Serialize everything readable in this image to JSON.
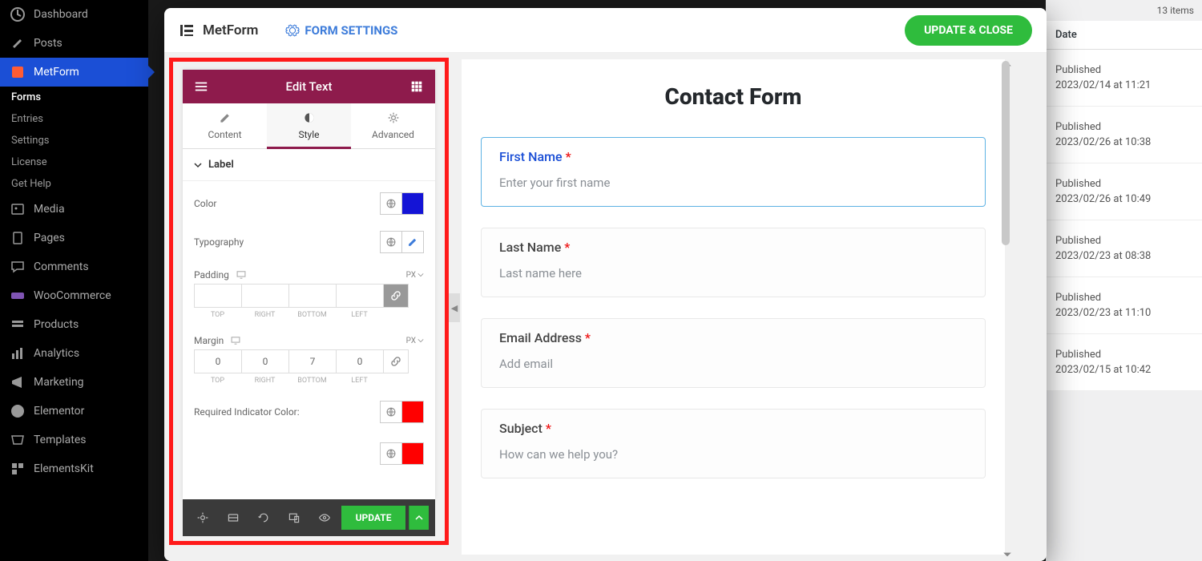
{
  "wp_sidebar": {
    "items": [
      {
        "label": "Dashboard",
        "icon": "dashboard"
      },
      {
        "label": "Posts",
        "icon": "pin"
      },
      {
        "label": "MetForm",
        "icon": "metform",
        "active": true
      },
      {
        "label": "Media",
        "icon": "media"
      },
      {
        "label": "Pages",
        "icon": "page"
      },
      {
        "label": "Comments",
        "icon": "comment"
      },
      {
        "label": "WooCommerce",
        "icon": "woo"
      },
      {
        "label": "Products",
        "icon": "products"
      },
      {
        "label": "Analytics",
        "icon": "analytics"
      },
      {
        "label": "Marketing",
        "icon": "marketing"
      },
      {
        "label": "Elementor",
        "icon": "elementor"
      },
      {
        "label": "Templates",
        "icon": "templates"
      },
      {
        "label": "ElementsKit",
        "icon": "elementskit"
      }
    ],
    "submenu": [
      "Forms",
      "Entries",
      "Settings",
      "License",
      "Get Help"
    ],
    "submenu_current": "Forms"
  },
  "right_col": {
    "items_count": "13 items",
    "header": "Date",
    "rows": [
      {
        "l1": "Published",
        "l2": "2023/02/14 at 11:21"
      },
      {
        "l1": "Published",
        "l2": "2023/02/26 at 10:38"
      },
      {
        "l1": "Published",
        "l2": "2023/02/26 at 10:49"
      },
      {
        "l1": "Published",
        "l2": "2023/02/23 at 08:38"
      },
      {
        "l1": "Published",
        "l2": "2023/02/23 at 11:10"
      },
      {
        "l1": "Published",
        "l2": "2023/02/15 at 10:42"
      }
    ]
  },
  "modal": {
    "brand": "MetForm",
    "form_settings": "FORM SETTINGS",
    "update_close": "UPDATE & CLOSE"
  },
  "panel": {
    "title": "Edit Text",
    "tabs": [
      "Content",
      "Style",
      "Advanced"
    ],
    "active_tab": "Style",
    "section_label": "Label",
    "color_label": "Color",
    "color_value": "#1414d6",
    "typography_label": "Typography",
    "padding_label": "Padding",
    "padding_unit": "PX",
    "padding_values": {
      "top": "",
      "right": "",
      "bottom": "",
      "left": ""
    },
    "box_sides": {
      "top": "TOP",
      "right": "RIGHT",
      "bottom": "BOTTOM",
      "left": "LEFT"
    },
    "margin_label": "Margin",
    "margin_unit": "PX",
    "margin_values": {
      "top": "0",
      "right": "0",
      "bottom": "7",
      "left": "0"
    },
    "req_indicator_label": "Required Indicator Color:",
    "req_indicator_color": "#ff0000",
    "update_btn": "UPDATE"
  },
  "form": {
    "title": "Contact Form",
    "fields": [
      {
        "label": "First Name",
        "required": true,
        "placeholder": "Enter your first name",
        "active": true,
        "boxed": true
      },
      {
        "label": "Last Name",
        "required": true,
        "placeholder": "Last name here",
        "boxed": true
      },
      {
        "label": "Email Address",
        "required": true,
        "placeholder": "Add email",
        "boxed": true
      },
      {
        "label": "Subject",
        "required": true,
        "placeholder": "How can we help you?",
        "boxed": true
      }
    ]
  }
}
